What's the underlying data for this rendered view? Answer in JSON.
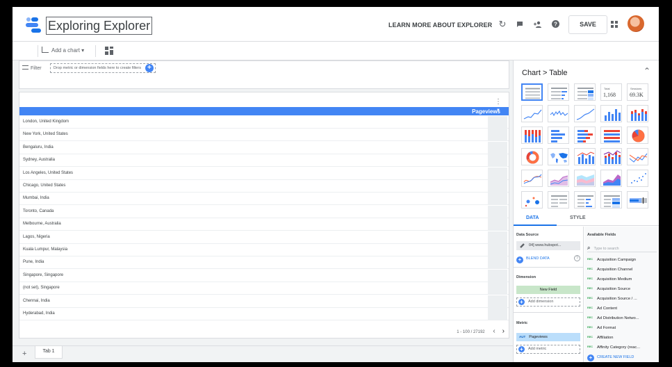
{
  "header": {
    "title": "Exploring Explorer",
    "learn_more": "LEARN MORE ABOUT EXPLORER",
    "save": "SAVE",
    "icons": [
      "refresh-icon",
      "feedback-icon",
      "add-person-icon",
      "help-icon",
      "apps-icon",
      "avatar"
    ]
  },
  "toolbar": {
    "add_chart": "Add a chart",
    "controls_icon": "controls-icon"
  },
  "filter": {
    "label": "Filter",
    "drop_hint": "Drop metric or dimension fields here to create filters"
  },
  "table": {
    "column": "Pageviews",
    "sort_indicator": "▼",
    "rows": [
      "London, United Kingdom",
      "New York, United States",
      "Bengaluru, India",
      "Sydney, Australia",
      "Los Angeles, United States",
      "Chicago, United States",
      "Mumbai, India",
      "Toronto, Canada",
      "Melbourne, Australia",
      "Lagos, Nigeria",
      "Kuala Lumpur, Malaysia",
      "Pune, India",
      "Singapore, Singapore",
      "(not set), Singapore",
      "Chennai, India",
      "Hyderabad, India"
    ],
    "pagination": "1 - 100 / 27192"
  },
  "tabs": {
    "add": "+",
    "tab1": "Tab 1"
  },
  "panel": {
    "breadcrumb": "Chart > Table",
    "scorecard_1": {
      "label": "Total",
      "value": "1,168"
    },
    "scorecard_2": {
      "label": "Sessions",
      "value": "69.3K"
    },
    "tab_data": "DATA",
    "tab_style": "STYLE",
    "data_source_label": "Data Source",
    "data_source": "04] www.hubspot...",
    "blend": "BLEND DATA",
    "dimension_label": "Dimension",
    "dimension_value": "New Field",
    "add_dimension": "Add dimension",
    "metric_label": "Metric",
    "metric_agg": "AUT",
    "metric_value": "Pageviews",
    "add_metric": "Add metric",
    "available_fields": "Available Fields",
    "search_placeholder": "Type to search",
    "field_type": "REC",
    "fields": [
      "Acquisition Campaign",
      "Acquisition Channel",
      "Acquisition Medium",
      "Acquisition Source",
      "Acquisition Source / ...",
      "Ad Content",
      "Ad Distribution Netwo...",
      "Ad Format",
      "Affiliation",
      "Affinity Category (reac..."
    ],
    "create_field": "CREATE NEW FIELD"
  },
  "colors": {
    "accent": "#4285f4",
    "link": "#1a73e8",
    "dimension": "#c8e6c9",
    "metric": "#bbdefb"
  }
}
